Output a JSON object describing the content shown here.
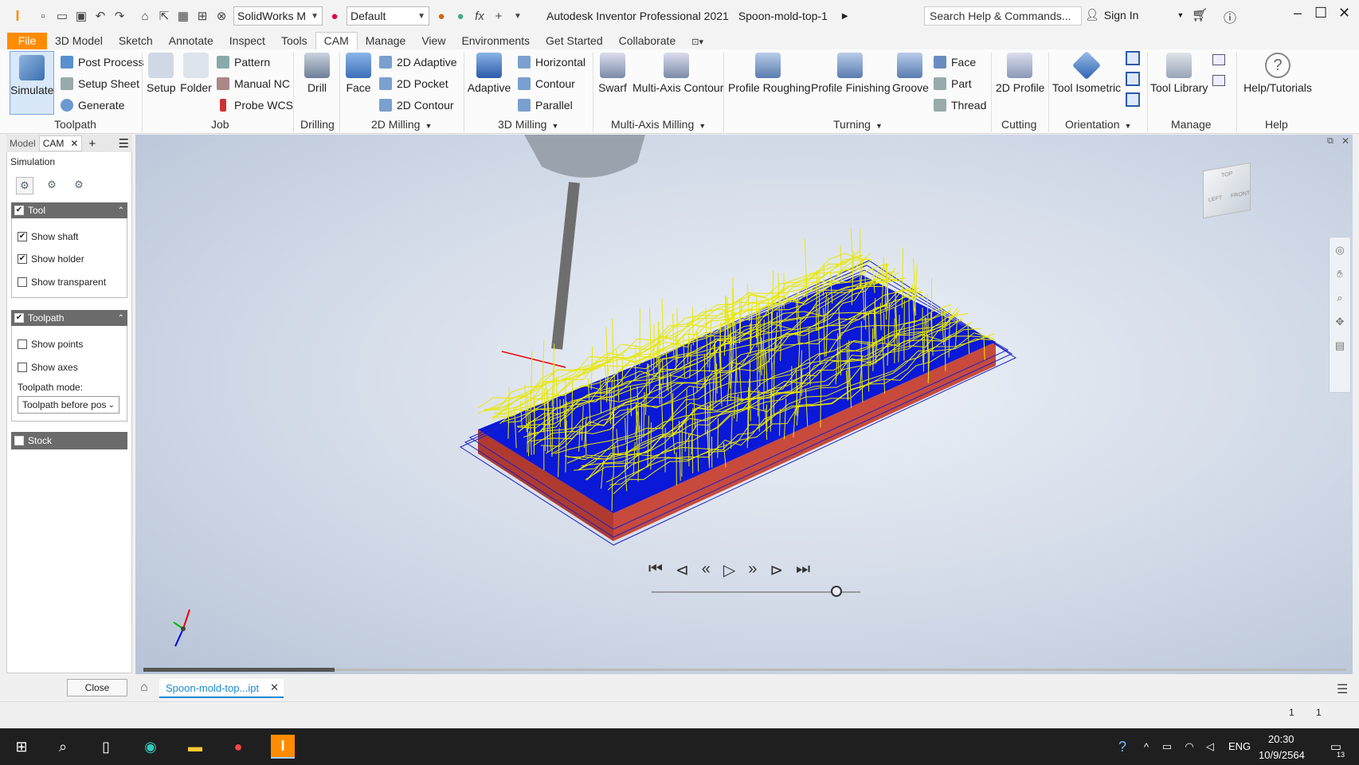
{
  "titlebar": {
    "app_title": "Autodesk Inventor Professional 2021",
    "doc_title": "Spoon-mold-top-1",
    "material_combo": "SolidWorks M",
    "appearance_combo": "Default",
    "search_placeholder": "Search Help & Commands...",
    "sign_in": "Sign In"
  },
  "menu": [
    "File",
    "3D Model",
    "Sketch",
    "Annotate",
    "Inspect",
    "Tools",
    "CAM",
    "Manage",
    "View",
    "Environments",
    "Get Started",
    "Collaborate"
  ],
  "ribbon": {
    "toolpath": {
      "simulate": "Simulate",
      "post_process": "Post Process",
      "setup_sheet": "Setup Sheet",
      "generate": "Generate",
      "label": "Toolpath"
    },
    "job": {
      "setup": "Setup",
      "folder": "Folder",
      "pattern": "Pattern",
      "manual_nc": "Manual NC",
      "probe_wcs": "Probe WCS",
      "label": "Job"
    },
    "drilling": {
      "drill": "Drill",
      "label": "Drilling"
    },
    "milling2d": {
      "face": "Face",
      "adaptive2d": "2D Adaptive",
      "pocket2d": "2D Pocket",
      "contour2d": "2D Contour",
      "label": "2D Milling"
    },
    "milling3d": {
      "adaptive": "Adaptive",
      "horizontal": "Horizontal",
      "contour": "Contour",
      "parallel": "Parallel",
      "label": "3D Milling"
    },
    "multiaxis": {
      "swarf": "Swarf",
      "multi_axis_contour": "Multi-Axis Contour",
      "label": "Multi-Axis Milling"
    },
    "turning": {
      "profile_roughing": "Profile Roughing",
      "profile_finishing": "Profile Finishing",
      "groove": "Groove",
      "face": "Face",
      "part": "Part",
      "thread": "Thread",
      "label": "Turning"
    },
    "cutting": {
      "profile2d": "2D Profile",
      "label": "Cutting"
    },
    "orientation": {
      "tool_isometric": "Tool Isometric",
      "label": "Orientation"
    },
    "manage": {
      "tool_library": "Tool Library",
      "label": "Manage"
    },
    "help": {
      "help_tutorials": "Help/Tutorials",
      "label": "Help"
    }
  },
  "browser": {
    "tabs": {
      "model": "Model",
      "cam": "CAM"
    },
    "title": "Simulation",
    "tool_section": {
      "title": "Tool",
      "show_shaft": "Show shaft",
      "show_holder": "Show holder",
      "show_transparent": "Show transparent"
    },
    "toolpath_section": {
      "title": "Toolpath",
      "show_points": "Show points",
      "show_axes": "Show axes",
      "mode_label": "Toolpath mode:",
      "mode_value": "Toolpath before pos"
    },
    "stock_section": {
      "title": "Stock"
    },
    "close": "Close"
  },
  "viewcube": {
    "top": "TOP",
    "left": "LEFT",
    "front": "FRONT"
  },
  "document_tab": "Spoon-mold-top...ipt",
  "status": {
    "count1": "1",
    "count2": "1"
  },
  "taskbar": {
    "lang": "ENG",
    "time": "20:30",
    "date": "10/9/2564",
    "notif": "13"
  },
  "colors": {
    "file_tab": "#ff8c00",
    "toolpath": "#e8e800",
    "stock_blue": "#0a18d8",
    "stock_red": "#c84a3c",
    "doc_tab_text": "#1a8ad4"
  }
}
